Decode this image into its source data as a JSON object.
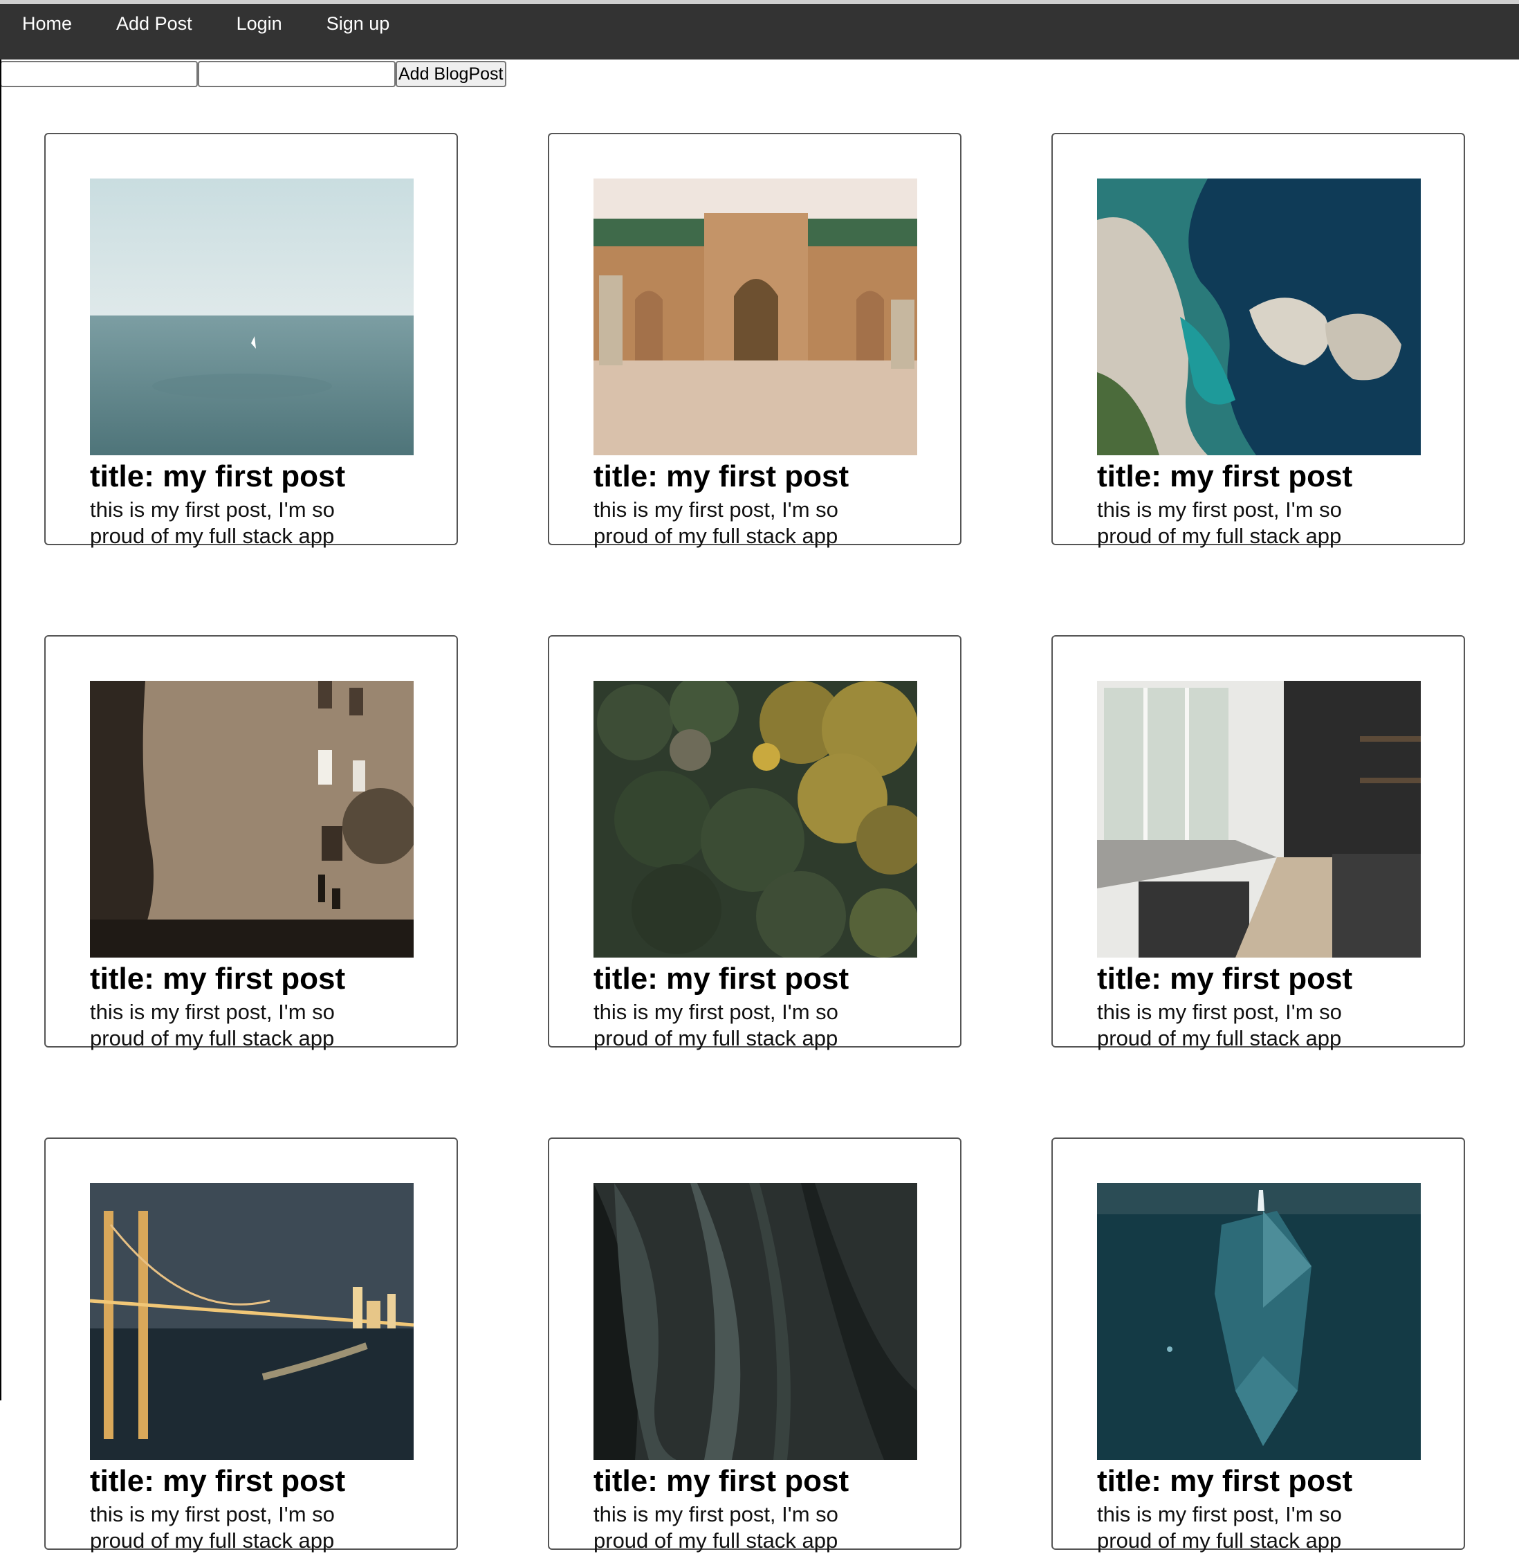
{
  "navbar": {
    "links": [
      {
        "label": "Home"
      },
      {
        "label": "Add Post"
      },
      {
        "label": "Login"
      },
      {
        "label": "Sign up"
      }
    ]
  },
  "form": {
    "title_value": "",
    "body_value": "",
    "submit_label": "Add BlogPost"
  },
  "posts": [
    {
      "title": "title: my first post",
      "body": "this is my first post, I'm so proud of my full stack app",
      "image": "sea-with-sailboat"
    },
    {
      "title": "title: my first post",
      "body": "this is my first post, I'm so proud of my full stack app",
      "image": "moroccan-palace-gate"
    },
    {
      "title": "title: my first post",
      "body": "this is my first post, I'm so proud of my full stack app",
      "image": "aerial-coastline"
    },
    {
      "title": "title: my first post",
      "body": "this is my first post, I'm so proud of my full stack app",
      "image": "building-wall-shadow"
    },
    {
      "title": "title: my first post",
      "body": "this is my first post, I'm so proud of my full stack app",
      "image": "aerial-forest"
    },
    {
      "title": "title: my first post",
      "body": "this is my first post, I'm so proud of my full stack app",
      "image": "modern-kitchen"
    },
    {
      "title": "title: my first post",
      "body": "this is my first post, I'm so proud of my full stack app",
      "image": "bridge-at-night"
    },
    {
      "title": "title: my first post",
      "body": "this is my first post, I'm so proud of my full stack app",
      "image": "dark-abstract-folds"
    },
    {
      "title": "title: my first post",
      "body": "this is my first post, I'm so proud of my full stack app",
      "image": "iceberg-underwater"
    }
  ],
  "colors": {
    "navbar_bg": "#333333",
    "nav_text": "#ffffff",
    "card_border": "#555555"
  }
}
